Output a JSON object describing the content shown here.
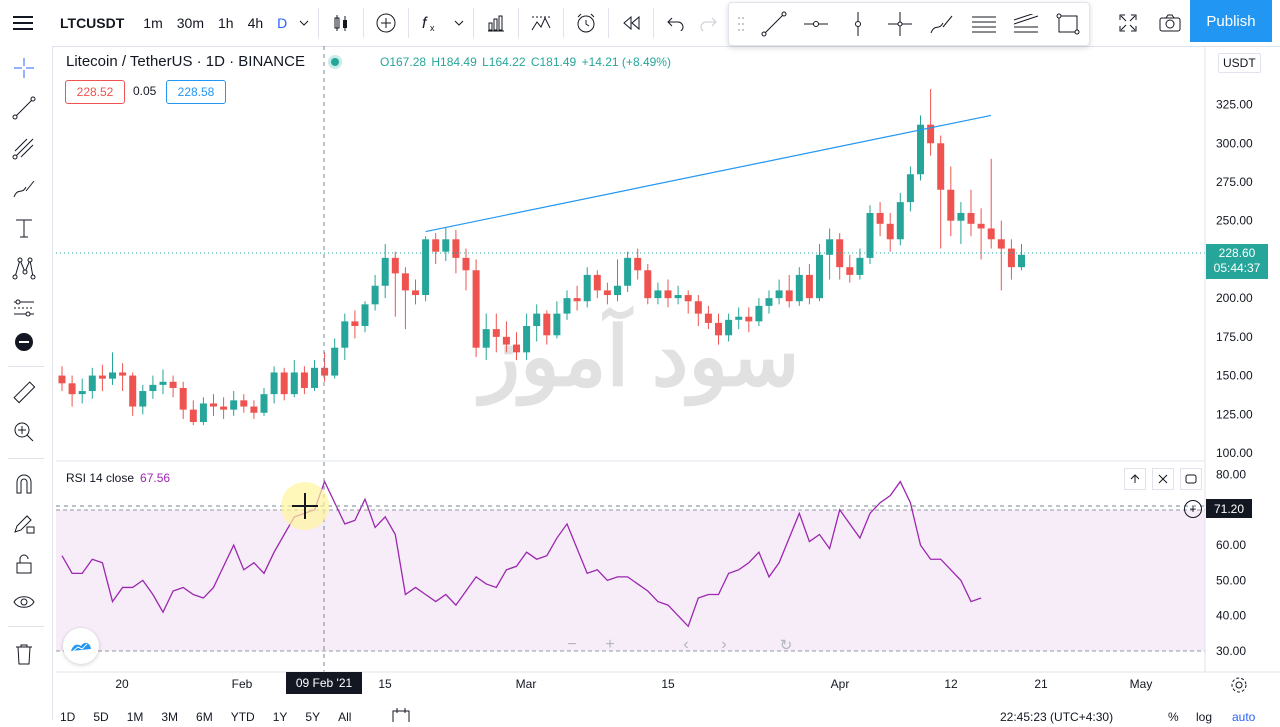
{
  "toolbar": {
    "symbol": "LTCUSDT",
    "intervals": [
      "1m",
      "30m",
      "1h",
      "4h",
      "D"
    ],
    "publish_label": "Publish"
  },
  "legend": {
    "title": "Litecoin / TetherUS · 1D · BINANCE",
    "o": "O167.28",
    "h": "H184.49",
    "l": "L164.22",
    "c": "C181.49",
    "chg": "+14.21 (+8.49%)",
    "bid": "228.52",
    "spread": "0.05",
    "ask": "228.58"
  },
  "currency": "USDT",
  "rsi": {
    "label": "RSI 14 close",
    "value": "67.56",
    "badge": "71.20"
  },
  "last_price": {
    "price": "228.60",
    "countdown": "05:44:37"
  },
  "crosshair_date": "09 Feb '21",
  "watermark": "سود آموز",
  "bottom": {
    "ranges": [
      "1D",
      "5D",
      "1M",
      "3M",
      "6M",
      "YTD",
      "1Y",
      "5Y",
      "All"
    ],
    "clock": "22:45:23 (UTC+4:30)",
    "pct": "%",
    "log": "log",
    "auto": "auto"
  },
  "colors": {
    "up": "#26a69a",
    "down": "#ef5350",
    "rsi": "#9c27b0",
    "accent": "#2962ff",
    "trend": "#2196f3"
  },
  "chart_data": [
    {
      "type": "candlestick",
      "y_ticks": [
        100,
        125,
        150,
        175,
        200,
        225,
        250,
        275,
        300,
        325
      ],
      "x_ticks": [
        "20",
        "Feb",
        "15",
        "Mar",
        "15",
        "Apr",
        "12",
        "21",
        "May"
      ],
      "y_range": [
        95,
        340
      ],
      "candles": [
        [
          150,
          145,
          156,
          140
        ],
        [
          145,
          138,
          150,
          130
        ],
        [
          138,
          140,
          148,
          132
        ],
        [
          140,
          150,
          155,
          135
        ],
        [
          150,
          148,
          157,
          140
        ],
        [
          148,
          152,
          165,
          144
        ],
        [
          152,
          150,
          158,
          140
        ],
        [
          150,
          130,
          152,
          124
        ],
        [
          130,
          140,
          144,
          125
        ],
        [
          140,
          144,
          150,
          135
        ],
        [
          144,
          146,
          154,
          138
        ],
        [
          146,
          142,
          150,
          136
        ],
        [
          142,
          128,
          146,
          122
        ],
        [
          128,
          120,
          134,
          118
        ],
        [
          120,
          132,
          136,
          118
        ],
        [
          132,
          130,
          138,
          124
        ],
        [
          130,
          128,
          136,
          122
        ],
        [
          128,
          134,
          140,
          124
        ],
        [
          134,
          130,
          138,
          126
        ],
        [
          130,
          126,
          134,
          122
        ],
        [
          126,
          138,
          142,
          124
        ],
        [
          138,
          152,
          156,
          132
        ],
        [
          152,
          138,
          155,
          134
        ],
        [
          138,
          152,
          160,
          136
        ],
        [
          152,
          142,
          156,
          138
        ],
        [
          142,
          155,
          160,
          140
        ],
        [
          155,
          150,
          165,
          146
        ],
        [
          150,
          168,
          174,
          148
        ],
        [
          168,
          185,
          190,
          160
        ],
        [
          185,
          182,
          192,
          174
        ],
        [
          182,
          196,
          198,
          178
        ],
        [
          196,
          208,
          215,
          192
        ],
        [
          208,
          226,
          235,
          200
        ],
        [
          226,
          216,
          230,
          188
        ],
        [
          216,
          205,
          220,
          180
        ],
        [
          205,
          202,
          212,
          196
        ],
        [
          202,
          238,
          240,
          198
        ],
        [
          238,
          230,
          242,
          222
        ],
        [
          230,
          238,
          246,
          224
        ],
        [
          238,
          226,
          244,
          216
        ],
        [
          226,
          218,
          232,
          205
        ],
        [
          218,
          168,
          225,
          162
        ],
        [
          168,
          180,
          190,
          160
        ],
        [
          180,
          175,
          190,
          165
        ],
        [
          175,
          170,
          185,
          165
        ],
        [
          170,
          165,
          178,
          160
        ],
        [
          165,
          182,
          190,
          160
        ],
        [
          182,
          190,
          196,
          172
        ],
        [
          190,
          176,
          192,
          170
        ],
        [
          176,
          190,
          198,
          174
        ],
        [
          190,
          200,
          205,
          186
        ],
        [
          200,
          198,
          208,
          192
        ],
        [
          198,
          215,
          220,
          194
        ],
        [
          215,
          205,
          218,
          200
        ],
        [
          205,
          202,
          210,
          196
        ],
        [
          202,
          208,
          225,
          198
        ],
        [
          208,
          226,
          230,
          204
        ],
        [
          226,
          218,
          232,
          212
        ],
        [
          218,
          200,
          222,
          196
        ],
        [
          200,
          205,
          210,
          196
        ],
        [
          205,
          200,
          212,
          194
        ],
        [
          200,
          202,
          208,
          196
        ],
        [
          202,
          198,
          205,
          190
        ],
        [
          198,
          190,
          202,
          182
        ],
        [
          190,
          184,
          195,
          180
        ],
        [
          184,
          176,
          190,
          170
        ],
        [
          176,
          186,
          190,
          172
        ],
        [
          186,
          188,
          194,
          180
        ],
        [
          188,
          185,
          194,
          178
        ],
        [
          185,
          195,
          200,
          182
        ],
        [
          195,
          200,
          205,
          190
        ],
        [
          200,
          205,
          212,
          196
        ],
        [
          205,
          198,
          215,
          194
        ],
        [
          198,
          215,
          220,
          195
        ],
        [
          215,
          200,
          222,
          196
        ],
        [
          200,
          228,
          235,
          198
        ],
        [
          228,
          238,
          245,
          212
        ],
        [
          238,
          220,
          242,
          212
        ],
        [
          220,
          215,
          228,
          210
        ],
        [
          215,
          226,
          232,
          212
        ],
        [
          226,
          255,
          260,
          222
        ],
        [
          255,
          248,
          262,
          240
        ],
        [
          248,
          238,
          255,
          230
        ],
        [
          238,
          262,
          268,
          234
        ],
        [
          262,
          280,
          285,
          256
        ],
        [
          280,
          312,
          318,
          276
        ],
        [
          312,
          300,
          335,
          292
        ],
        [
          300,
          270,
          305,
          232
        ],
        [
          270,
          250,
          285,
          240
        ],
        [
          250,
          255,
          262,
          235
        ],
        [
          255,
          248,
          270,
          240
        ],
        [
          248,
          245,
          258,
          225
        ],
        [
          245,
          238,
          290,
          232
        ],
        [
          238,
          232,
          250,
          205
        ],
        [
          232,
          220,
          238,
          212
        ],
        [
          220,
          228,
          235,
          218
        ]
      ],
      "trendline": {
        "from": [
          37,
          243
        ],
        "to": [
          90,
          318
        ]
      }
    },
    {
      "type": "line",
      "name": "RSI 14 close",
      "y_ticks": [
        30,
        40,
        50,
        60,
        70,
        80
      ],
      "levels": [
        30,
        70
      ],
      "values": [
        57,
        52,
        52,
        56,
        55,
        44,
        48,
        48,
        50,
        46,
        41,
        47,
        48,
        46,
        45,
        48,
        54,
        60,
        53,
        55,
        52,
        58,
        63,
        68,
        69,
        70,
        78,
        72,
        66,
        67,
        73,
        65,
        68,
        63,
        46,
        48,
        46,
        44,
        46,
        43,
        47,
        51,
        49,
        48,
        53,
        54,
        58,
        56,
        57,
        62,
        66,
        59,
        52,
        53,
        50,
        51,
        51,
        49,
        47,
        44,
        43,
        40,
        37,
        45,
        46,
        46,
        52,
        53,
        55,
        58,
        51,
        55,
        62,
        69,
        61,
        63,
        59,
        70,
        66,
        62,
        69,
        72,
        74,
        78,
        72,
        60,
        56,
        56,
        53,
        50,
        44,
        45
      ]
    }
  ]
}
